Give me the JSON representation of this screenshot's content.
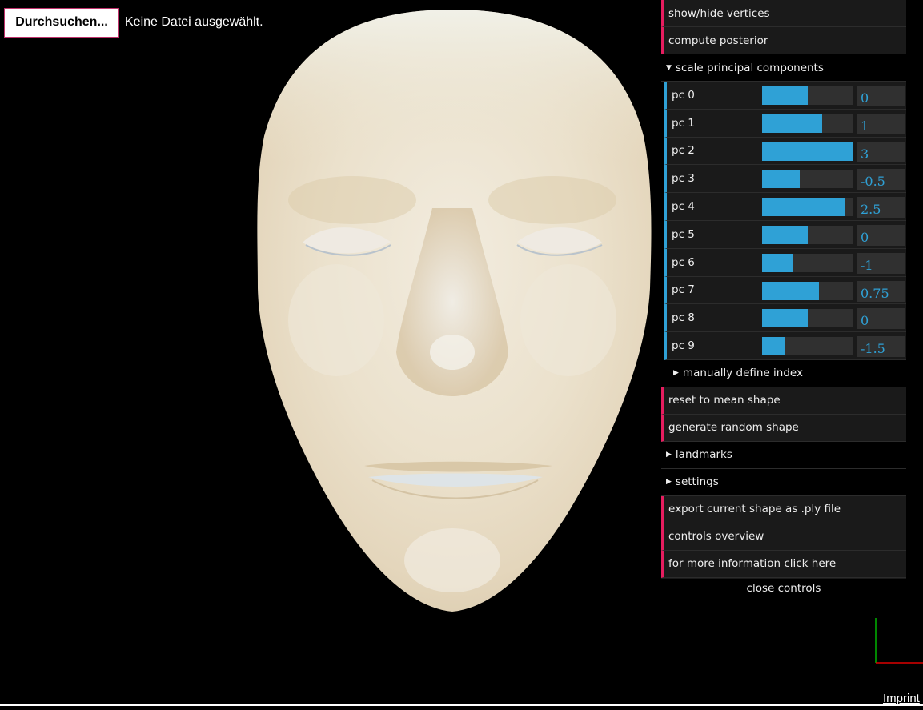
{
  "file_input": {
    "button_label": "Durchsuchen...",
    "status": "Keine Datei ausgewählt."
  },
  "controls": {
    "show_hide_vertices": "show/hide vertices",
    "compute_posterior": "compute posterior",
    "scale_pc_folder": "scale principal components",
    "principal_components": [
      {
        "label": "pc 0",
        "value": "0",
        "fill": 0.5
      },
      {
        "label": "pc 1",
        "value": "1",
        "fill": 0.667
      },
      {
        "label": "pc 2",
        "value": "3",
        "fill": 1.0
      },
      {
        "label": "pc 3",
        "value": "-0.5",
        "fill": 0.417
      },
      {
        "label": "pc 4",
        "value": "2.5",
        "fill": 0.917
      },
      {
        "label": "pc 5",
        "value": "0",
        "fill": 0.5
      },
      {
        "label": "pc 6",
        "value": "-1",
        "fill": 0.333
      },
      {
        "label": "pc 7",
        "value": "0.75",
        "fill": 0.625
      },
      {
        "label": "pc 8",
        "value": "0",
        "fill": 0.5
      },
      {
        "label": "pc 9",
        "value": "-1.5",
        "fill": 0.25
      }
    ],
    "manually_define_index": "manually define index",
    "reset_to_mean_shape": "reset to mean shape",
    "generate_random_shape": "generate random shape",
    "landmarks_folder": "landmarks",
    "settings_folder": "settings",
    "export_ply": "export current shape as .ply file",
    "controls_overview": "controls overview",
    "more_info": "for more information click here",
    "close_controls": "close controls"
  },
  "footer": {
    "imprint": "Imprint"
  },
  "colors": {
    "function_accent": "#e61d5f",
    "number_accent": "#2fa1d6",
    "panel_bg": "#1a1a1a"
  },
  "icons": {
    "folder_open": "triangle-down-icon",
    "folder_closed": "triangle-right-icon"
  }
}
